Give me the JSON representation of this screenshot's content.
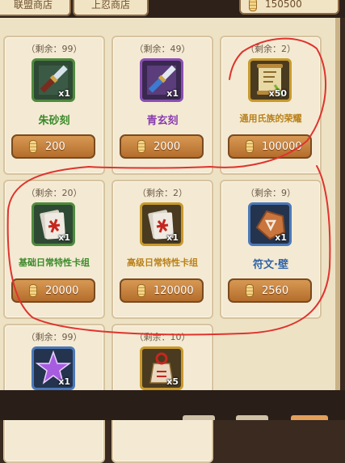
{
  "tabs": [
    {
      "label": "联盟商店"
    },
    {
      "label": "上忍商店"
    }
  ],
  "currency": {
    "amount": "150500",
    "icon": "coin-stack-icon"
  },
  "remain_format": "（剩余：{n}）",
  "items": [
    {
      "id": "zhushake",
      "remaining": "（剩余：99）",
      "name": "朱砂刻",
      "qty": "x1",
      "price": "200",
      "rarity": "green",
      "icon": "ink-brush-icon"
    },
    {
      "id": "qingxuanke",
      "remaining": "（剩余：49）",
      "name": "青玄刻",
      "qty": "x1",
      "price": "2000",
      "rarity": "purple",
      "icon": "ink-brush-icon"
    },
    {
      "id": "tongyong",
      "remaining": "（剩余：2）",
      "name": "通用氏族的荣耀",
      "qty": "x50",
      "price": "100000",
      "rarity": "gold",
      "icon": "scroll-icon"
    },
    {
      "id": "jichu",
      "remaining": "（剩余：20）",
      "name": "基础日常特性卡组",
      "qty": "x1",
      "price": "20000",
      "rarity": "green",
      "icon": "card-deck-icon"
    },
    {
      "id": "gaoji",
      "remaining": "（剩余：2）",
      "name": "高级日常特性卡组",
      "qty": "x1",
      "price": "120000",
      "rarity": "gold",
      "icon": "card-deck-icon"
    },
    {
      "id": "fuwen",
      "remaining": "（剩余：9）",
      "name": "符文·壁",
      "qty": "x1",
      "price": "2560",
      "rarity": "blue",
      "icon": "rune-stone-icon"
    },
    {
      "id": "star",
      "remaining": "（剩余：99）",
      "name": "",
      "qty": "x1",
      "price": "",
      "rarity": "blue",
      "icon": "purple-star-icon"
    },
    {
      "id": "charm",
      "remaining": "（剩余：10）",
      "name": "",
      "qty": "x5",
      "price": "",
      "rarity": "gold",
      "icon": "charm-bag-icon"
    }
  ],
  "annotation": {
    "color": "#e0332e"
  }
}
